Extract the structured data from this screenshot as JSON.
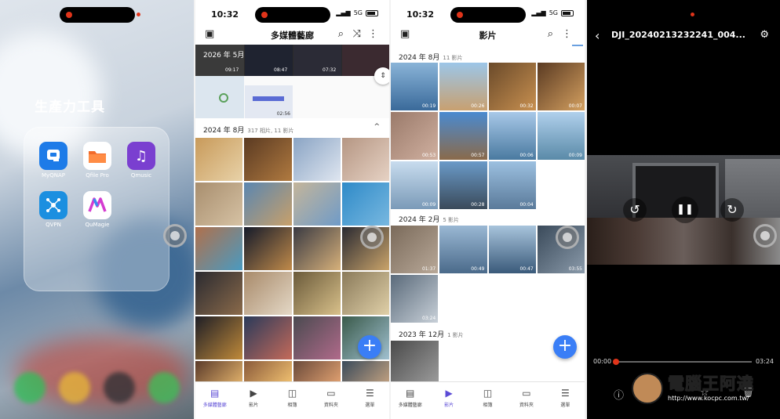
{
  "home": {
    "folder_title": "生產力工具",
    "apps": [
      {
        "label": "MyQNAP",
        "icon": "q-logo-icon",
        "color": "#1d7be8"
      },
      {
        "label": "Qfile Pro",
        "icon": "folder-icon",
        "color": "#f26b2b"
      },
      {
        "label": "Qmusic",
        "icon": "music-note-icon",
        "color": "#7a3fd0"
      },
      {
        "label": "QVPN",
        "icon": "network-icon",
        "color": "#1b8fe0"
      },
      {
        "label": "QuMagie",
        "icon": "m-logo-icon",
        "color": "#ffffff"
      }
    ]
  },
  "gallery": {
    "time": "10:32",
    "network": "5G",
    "title": "多媒體藝廊",
    "sections": [
      {
        "header": "2026 年 5月",
        "durations": [
          "09:17",
          "08:47",
          "07:32",
          "",
          "",
          "02:56"
        ]
      },
      {
        "header": "2024 年 8月",
        "sub": "317 相片, 11 影片"
      }
    ],
    "tabs": [
      {
        "label": "多媒體藝廊",
        "icon": "gallery-icon"
      },
      {
        "label": "影片",
        "icon": "play-icon"
      },
      {
        "label": "相簿",
        "icon": "album-icon"
      },
      {
        "label": "資料夾",
        "icon": "folder-icon"
      },
      {
        "label": "選單",
        "icon": "menu-icon"
      }
    ],
    "fab": "+",
    "collapse": "^"
  },
  "videos": {
    "time": "10:32",
    "network": "5G",
    "title": "影片",
    "sections": [
      {
        "header": "2024 年 8月",
        "sub": "11 影片",
        "durations": [
          "00:19",
          "00:26",
          "00:32",
          "00:07",
          "00:53",
          "00:57",
          "00:06",
          "00:09",
          "00:09",
          "00:28",
          "00:04"
        ]
      },
      {
        "header": "2024 年 2月",
        "sub": "5 影片",
        "durations": [
          "01:37",
          "00:49",
          "00:47",
          "03:55",
          "03:24"
        ]
      },
      {
        "header": "2023 年 12月",
        "sub": "1 影片",
        "durations": [
          ""
        ]
      }
    ],
    "tabs": [
      {
        "label": "多媒體藝廊",
        "icon": "gallery-icon"
      },
      {
        "label": "影片",
        "icon": "play-icon"
      },
      {
        "label": "相簿",
        "icon": "album-icon"
      },
      {
        "label": "資料夾",
        "icon": "folder-icon"
      },
      {
        "label": "選單",
        "icon": "menu-icon"
      }
    ],
    "fab": "+"
  },
  "player": {
    "title": "DJI_20240213232241_004...",
    "current_time": "00:00",
    "total_time": "03:24",
    "progress": 0,
    "controls": {
      "rewind": "↺",
      "pause": "❚❚",
      "forward": "↻"
    }
  },
  "watermark": {
    "name": "電腦王阿達",
    "url": "http://www.kocpc.com.tw/"
  }
}
